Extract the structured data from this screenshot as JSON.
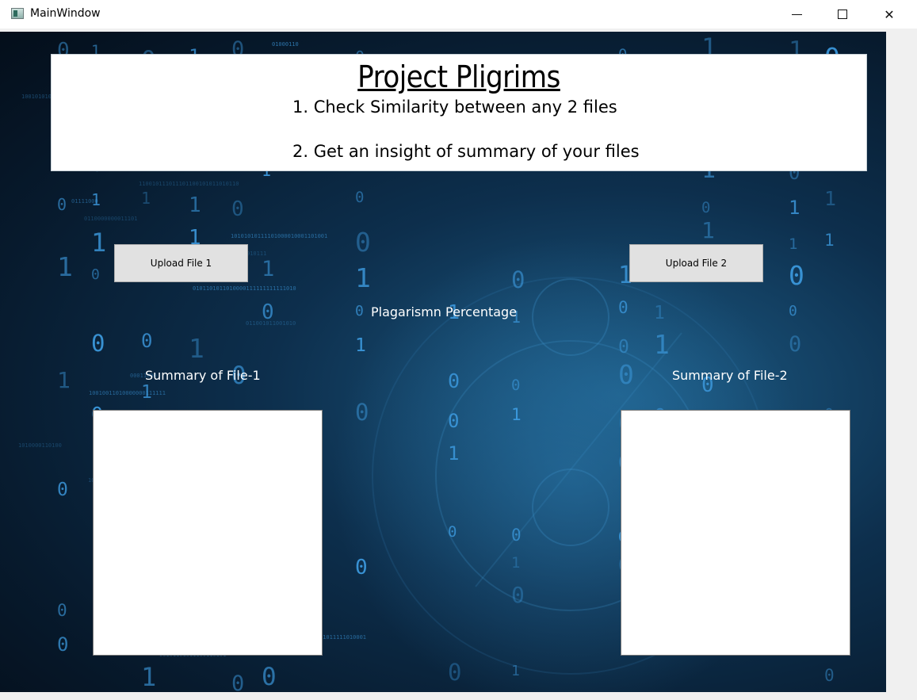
{
  "window": {
    "title": "MainWindow",
    "minimize_glyph": "",
    "maximize_glyph": "",
    "close_glyph": "✕"
  },
  "header": {
    "title": "Project Pligrims",
    "line1": "1. Check Similarity between any 2 files",
    "line2": "2. Get an insight of summary of your files"
  },
  "buttons": {
    "upload1": "Upload File 1",
    "upload2": "Upload File 2"
  },
  "labels": {
    "plagiarism": "Plagarismn Percentage",
    "summary1": "Summary of File-1",
    "summary2": "Summary of File-2"
  },
  "summaries": {
    "file1": "",
    "file2": ""
  },
  "colors": {
    "background_dark": "#071a2d",
    "digit_blue": "#3d9be0"
  }
}
